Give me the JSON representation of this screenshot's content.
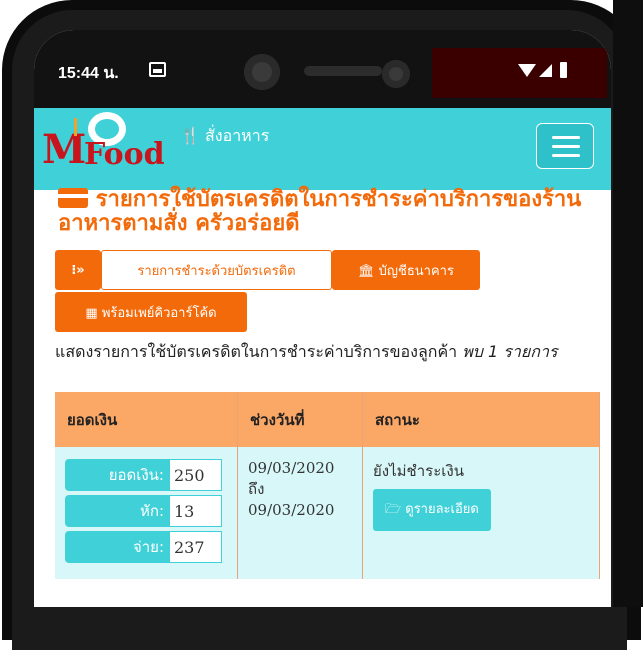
{
  "status_bar": {
    "time": "15:44 น."
  },
  "navbar": {
    "logo_m": "M",
    "logo_food": "Food",
    "brand": "🍴 สั่งอาหาร"
  },
  "page": {
    "title": "รายการใช้บัตรเครดิตในการชำระค่าบริการของร้านอาหารตามสั่ง ครัวอร่อยดี",
    "tab_toggle": "⁝»",
    "tab_card_payments": "รายการชำระด้วยบัตรเครดิต",
    "tab_bank": "🏛 บัญชีธนาคาร",
    "tab_promptpay": "▦ พร้อมเพย์คิวอาร์โค้ด",
    "description": "แสดงรายการใช้บัตรเครดิตในการชำระค่าบริการของลูกค้า",
    "found": "พบ 1 รายการ"
  },
  "table": {
    "headers": [
      "ยอดเงิน",
      "ช่วงวันที่",
      "สถานะ"
    ],
    "rows": [
      {
        "amount_label": "ยอดเงิน:",
        "amount": "250",
        "deduct_label": "หัก:",
        "deduct": "13",
        "pay_label": "จ่าย:",
        "pay": "237",
        "date_from": "09/03/2020",
        "date_to_word": "ถึง",
        "date_to": "09/03/2020",
        "status": "ยังไม่ชำระเงิน",
        "detail_button": "🗁 ดูรายละเอียด"
      }
    ]
  },
  "colors": {
    "accent": "#f26a0a",
    "teal": "#40d1d8",
    "header_bg": "#fba766",
    "row_bg": "#d8f7f8"
  }
}
